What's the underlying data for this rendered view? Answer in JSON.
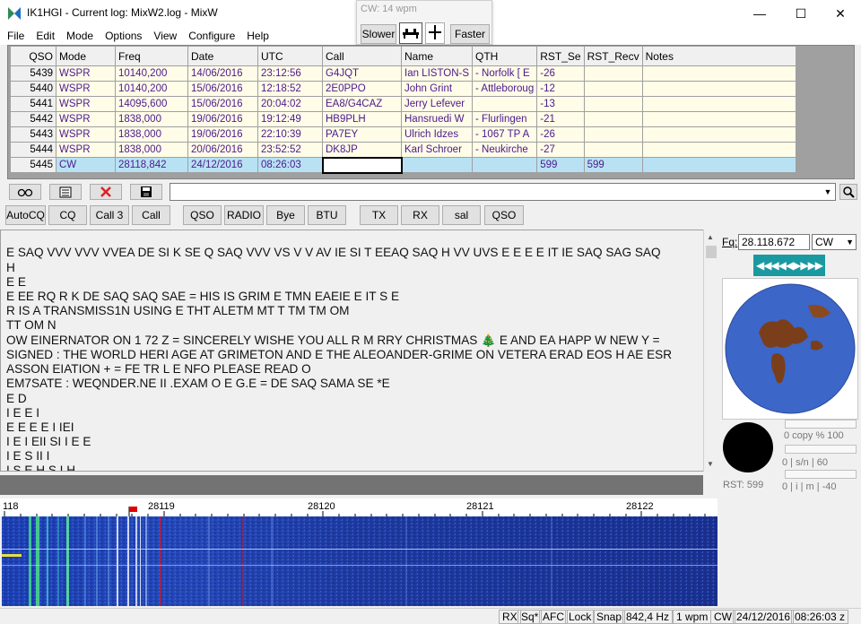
{
  "window": {
    "title": "IK1HGI - Current log: MixW2.log - MixW",
    "minimize": "—",
    "maximize": "☐",
    "close": "✕"
  },
  "menu": [
    "File",
    "Edit",
    "Mode",
    "Options",
    "View",
    "Configure",
    "Help"
  ],
  "cw_popup": {
    "label": "CW: 14 wpm",
    "slower": "Slower",
    "faster": "Faster"
  },
  "log": {
    "columns": [
      "QSO",
      "Mode",
      "Freq",
      "Date",
      "UTC",
      "Call",
      "Name",
      "QTH",
      "RST_Se",
      "RST_Recv",
      "Notes"
    ],
    "rows": [
      [
        "5439",
        "WSPR",
        "10140,200",
        "14/06/2016",
        "23:12:56",
        "G4JQT",
        "Ian LISTON-S",
        "- Norfolk [ E",
        "-26",
        "",
        ""
      ],
      [
        "5440",
        "WSPR",
        "10140,200",
        "15/06/2016",
        "12:18:52",
        "2E0PPO",
        "John Grint",
        "- Attleboroug",
        "-12",
        "",
        ""
      ],
      [
        "5441",
        "WSPR",
        "14095,600",
        "15/06/2016",
        "20:04:02",
        "EA8/G4CAZ",
        "Jerry Lefever",
        "",
        "-13",
        "",
        ""
      ],
      [
        "5442",
        "WSPR",
        "1838,000",
        "19/06/2016",
        "19:12:49",
        "HB9PLH",
        "Hansruedi W",
        "- Flurlingen",
        "-21",
        "",
        ""
      ],
      [
        "5443",
        "WSPR",
        "1838,000",
        "19/06/2016",
        "22:10:39",
        "PA7EY",
        "Ulrich Idzes",
        "- 1067 TP A",
        "-26",
        "",
        ""
      ],
      [
        "5444",
        "WSPR",
        "1838,000",
        "20/06/2016",
        "23:52:52",
        "DK8JP",
        "Karl Schroer",
        "- Neukirche",
        "-27",
        "",
        ""
      ],
      [
        "5445",
        "CW",
        "28118,842",
        "24/12/2016",
        "08:26:03",
        "",
        "",
        "",
        "599",
        "599",
        ""
      ]
    ]
  },
  "macros": [
    "AutoCQ",
    "CQ",
    "Call 3",
    "Call",
    "QSO",
    "RADIO",
    "Bye",
    "BTU",
    "TX",
    "RX",
    "sal",
    "QSO"
  ],
  "rx_lines": [
    "E SAQ VVV VVV VVEA DE SI K SE Q SAQ VVV VS V V AV IE SI T EEAQ SAQ H VV UVS E E E E IT IE SAQ SAG SAQ",
    "H",
    "E E",
    "E EE RQ R K DE SAQ SAQ SAE = HIS IS GRIM E TMN EAEIE E IT S E",
    "R IS A TRANSMISS1N USING E THT ALETM MT T TM TM OM",
    "TT OM N",
    "OW EINERNATOR ON 1 72 Z =  SINCERELY WISHE YOU ALL R M RRY CHRISTMAS 🎄 E AND EA HAPP W NEW Y =",
    "SIGNED : THE WORLD HERI AGE AT GRIMETON AND E THE ALEOANDER-GRIME ON VETERA ERAD EOS H AE ESR",
    "ASSON EIATION + = FE TR L E NFO PLEASE READ O",
    "EM7SATE : WEQNDER.NE II .EXAM O E G.E = DE SAQ SAMA SE  *E",
    "E D",
    "I E E I",
    "E E E E I IEI",
    "I E I EII SI I E E",
    "I E S II I",
    "I S E H S I H"
  ],
  "ruler": [
    "118",
    "28119",
    "28120",
    "28121",
    "28122"
  ],
  "right_panel": {
    "fq_label": "Fq:",
    "fq_value": "28.118.672",
    "mode_value": "CW",
    "arrows": "◀◀◀◀◀▶▶▶▶",
    "copy_label": "0   copy %    100",
    "sn_label": "0       | s/n |      60",
    "rst_label": "RST: 599",
    "imd_label": "0   | i | m |   -40"
  },
  "status": [
    "RX",
    "Sq*",
    "AFC",
    "Lock",
    "Snap",
    "842,4 Hz",
    "1 wpm",
    "CW",
    "24/12/2016",
    "08:26:03 z"
  ]
}
